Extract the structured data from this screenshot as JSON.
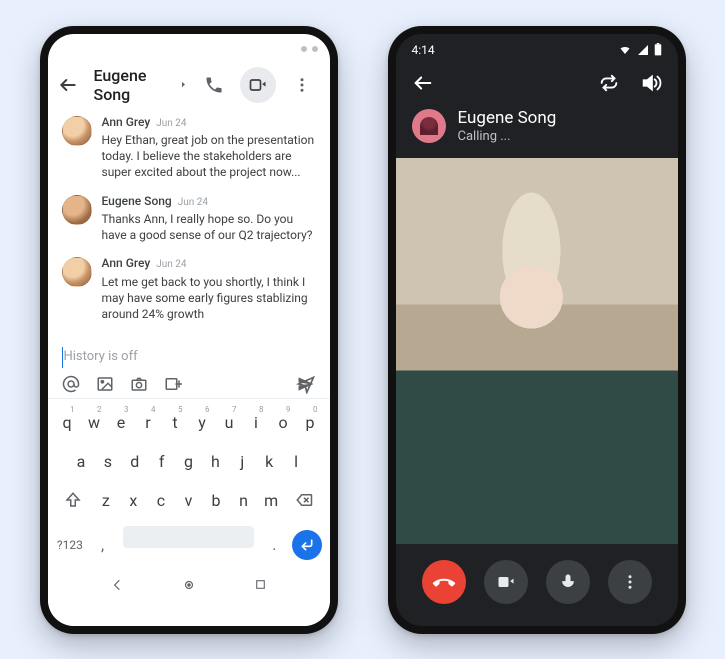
{
  "left": {
    "header": {
      "contact": "Eugene Song"
    },
    "messages": [
      {
        "name": "Ann Grey",
        "time": "Jun 24",
        "text": "Hey Ethan, great job on the presentation today. I believe the stakeholders are super excited about the project now..."
      },
      {
        "name": "Eugene Song",
        "time": "Jun 24",
        "text": "Thanks Ann, I really hope so. Do you have a good sense of our Q2 trajectory?"
      },
      {
        "name": "Ann Grey",
        "time": "Jun 24",
        "text": "Let me get back to you shortly, I think I may have some early figures stablizing around 24% growth"
      }
    ],
    "compose": {
      "placeholder": "History is off"
    },
    "keyboard": {
      "row1": [
        "q",
        "w",
        "e",
        "r",
        "t",
        "y",
        "u",
        "i",
        "o",
        "p"
      ],
      "row1_hints": [
        "1",
        "2",
        "3",
        "4",
        "5",
        "6",
        "7",
        "8",
        "9",
        "0"
      ],
      "row2": [
        "a",
        "s",
        "d",
        "f",
        "g",
        "h",
        "j",
        "k",
        "l"
      ],
      "row3": [
        "z",
        "x",
        "c",
        "v",
        "b",
        "n",
        "m"
      ],
      "symKey": "?123",
      "comma": ",",
      "period": "."
    }
  },
  "right": {
    "status": {
      "time": "4:14"
    },
    "caller": {
      "name": "Eugene Song",
      "status": "Calling ..."
    }
  }
}
